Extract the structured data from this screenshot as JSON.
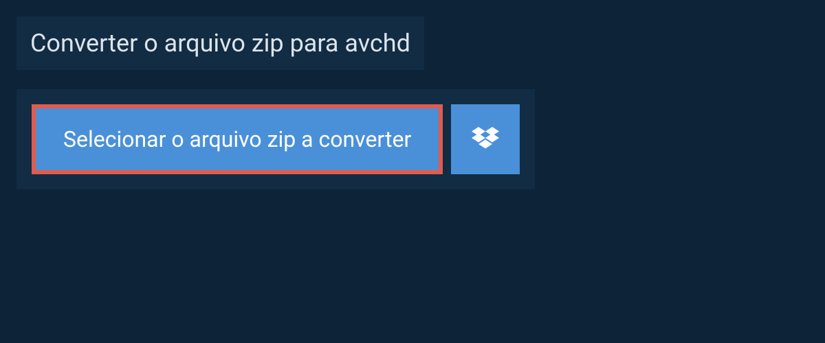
{
  "header": {
    "title": "Converter o arquivo zip para avchd"
  },
  "actions": {
    "select_file_label": "Selecionar o arquivo zip a converter"
  }
}
